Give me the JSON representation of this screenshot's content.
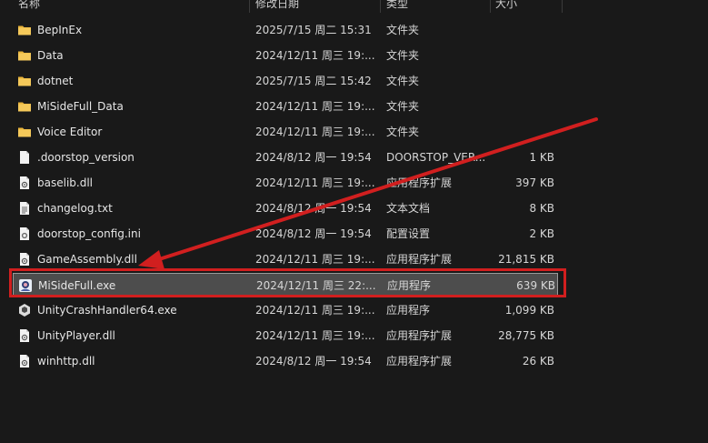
{
  "columns": {
    "name": "名称",
    "date": "修改日期",
    "type": "类型",
    "size": "大小"
  },
  "files": [
    {
      "name": "BepInEx",
      "date": "2025/7/15 周二 15:31",
      "type": "文件夹",
      "size": "",
      "icon": "folder-icon"
    },
    {
      "name": "Data",
      "date": "2024/12/11 周三 19:...",
      "type": "文件夹",
      "size": "",
      "icon": "folder-icon"
    },
    {
      "name": "dotnet",
      "date": "2025/7/15 周二 15:42",
      "type": "文件夹",
      "size": "",
      "icon": "folder-icon"
    },
    {
      "name": "MiSideFull_Data",
      "date": "2024/12/11 周三 19:...",
      "type": "文件夹",
      "size": "",
      "icon": "folder-icon"
    },
    {
      "name": "Voice Editor",
      "date": "2024/12/11 周三 19:...",
      "type": "文件夹",
      "size": "",
      "icon": "folder-icon"
    },
    {
      "name": ".doorstop_version",
      "date": "2024/8/12 周一 19:54",
      "type": "DOORSTOP_VER...",
      "size": "1 KB",
      "icon": "file-icon"
    },
    {
      "name": "baselib.dll",
      "date": "2024/12/11 周三 19:...",
      "type": "应用程序扩展",
      "size": "397 KB",
      "icon": "dll-icon"
    },
    {
      "name": "changelog.txt",
      "date": "2024/8/12 周一 19:54",
      "type": "文本文档",
      "size": "8 KB",
      "icon": "text-file-icon"
    },
    {
      "name": "doorstop_config.ini",
      "date": "2024/8/12 周一 19:54",
      "type": "配置设置",
      "size": "2 KB",
      "icon": "config-file-icon"
    },
    {
      "name": "GameAssembly.dll",
      "date": "2024/12/11 周三 19:...",
      "type": "应用程序扩展",
      "size": "21,815 KB",
      "icon": "dll-icon"
    },
    {
      "name": "MiSideFull.exe",
      "date": "2024/12/11 周三 22:...",
      "type": "应用程序",
      "size": "639 KB",
      "icon": "app-icon"
    },
    {
      "name": "UnityCrashHandler64.exe",
      "date": "2024/12/11 周三 19:...",
      "type": "应用程序",
      "size": "1,099 KB",
      "icon": "unity-icon"
    },
    {
      "name": "UnityPlayer.dll",
      "date": "2024/12/11 周三 19:...",
      "type": "应用程序扩展",
      "size": "28,775 KB",
      "icon": "dll-icon"
    },
    {
      "name": "winhttp.dll",
      "date": "2024/8/12 周一 19:54",
      "type": "应用程序扩展",
      "size": "26 KB",
      "icon": "dll-icon"
    }
  ],
  "selected_file": "MiSideFull.exe",
  "colors": {
    "annotation": "#d11f1f",
    "folder": "#f2c14e",
    "selection": "#4d4d4d"
  }
}
